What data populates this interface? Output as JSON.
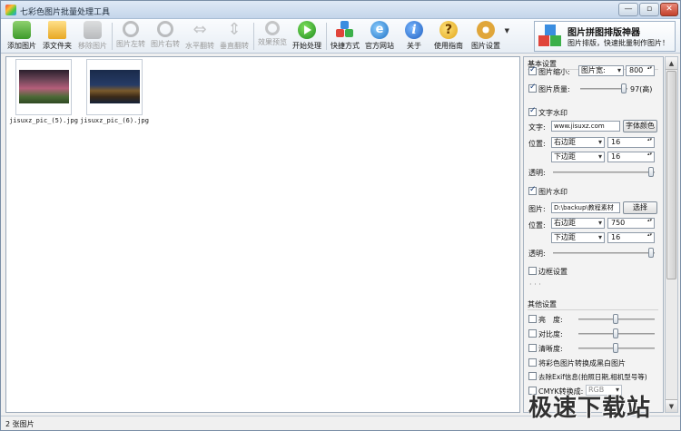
{
  "window": {
    "title": "七彩色图片批量处理工具"
  },
  "toolbar": {
    "add_image": "添加图片",
    "add_folder": "添文件夹",
    "remove_image": "移除图片",
    "rotate_left": "图片左转",
    "rotate_right": "图片右转",
    "flip_horizontal": "水平翻转",
    "flip_vertical": "垂直翻转",
    "effect_preview": "效果预览",
    "start_process": "开始处理",
    "shortcut": "快捷方式",
    "website": "官方网站",
    "about": "关于",
    "guide": "使用指南",
    "settings": "图片设置"
  },
  "promo": {
    "title": "图片拼图排版神器",
    "subtitle": "图片排版，快速批量制作图片！"
  },
  "images": [
    {
      "name": "jisuxz_pic_(5).jpg"
    },
    {
      "name": "jisuxz_pic_(6).jpg"
    }
  ],
  "panel": {
    "basic": {
      "title": "基本设置",
      "resize_label": "图片缩小:",
      "resize_mode": "图片宽:",
      "resize_value": "800",
      "quality_label": "图片质量:",
      "quality_value": "97(高)",
      "quality_level": 0.97
    },
    "text_watermark": {
      "title": "文字水印",
      "text_label": "文字:",
      "text_value": "www.jisuxz.com",
      "font_color_button": "字体颜色",
      "position_label": "位置:",
      "h_anchor": "右边距",
      "h_value": "16",
      "v_anchor": "下边距",
      "v_value": "16",
      "opacity_label": "透明:"
    },
    "image_watermark": {
      "title": "图片水印",
      "image_label": "图片:",
      "image_path": "D:\\backup\\教程素材",
      "select_button": "选择",
      "position_label": "位置:",
      "h_anchor": "右边距",
      "h_value": "750",
      "v_anchor": "下边距",
      "v_value": "16",
      "opacity_label": "透明:"
    },
    "border": {
      "title": "边框设置",
      "dots": "· · ·"
    },
    "other": {
      "title": "其他设置",
      "brightness": "亮　度:",
      "contrast": "对比度:",
      "sharpness": "清晰度:",
      "grayscale": "将彩色图片转换成黑白图片",
      "remove_exif": "去除Exif信息(拍照日期,相机型号等)",
      "cmyk_label": "CMYK转换成:",
      "cmyk_value": "RGB"
    }
  },
  "status": {
    "count": "2 张图片"
  },
  "watermark": "极速下载站",
  "colors": {
    "title_bar": "#c4d5ea",
    "panel_bg": "#f3f3f3",
    "accent": "#1a3f7a"
  }
}
